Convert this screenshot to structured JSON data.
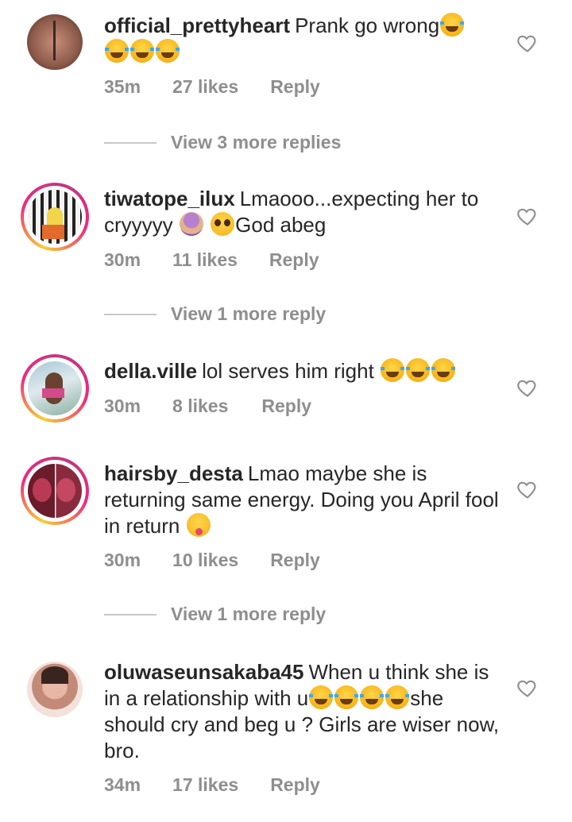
{
  "comments": [
    {
      "username": "official_prettyheart",
      "text_before": "Prank go wrong",
      "emoji_line": "😂😂😂😂",
      "time": "35m",
      "likes": "27 likes",
      "reply": "Reply",
      "view_replies": "View 3 more replies"
    },
    {
      "username": "tiwatope_ilux",
      "text": "Lmaooo...expecting her to cryyyyy",
      "text_after": "God abeg",
      "time": "30m",
      "likes": "11 likes",
      "reply": "Reply",
      "view_replies": "View 1 more reply"
    },
    {
      "username": "della.ville",
      "text": "lol serves him right",
      "time": "30m",
      "likes": "8 likes",
      "reply": "Reply"
    },
    {
      "username": "hairsby_desta",
      "text": "Lmao maybe she is returning same energy. Doing you April fool in return",
      "time": "30m",
      "likes": "10 likes",
      "reply": "Reply",
      "view_replies": "View 1 more reply"
    },
    {
      "username": "oluwaseunsakaba45",
      "text_before": "When u think she is in a relationship with u",
      "text_after": "she should cry and beg u ? Girls are wiser now, bro.",
      "time": "34m",
      "likes": "17 likes",
      "reply": "Reply"
    }
  ],
  "icons": {
    "like": "heart-outline-icon"
  },
  "colors": {
    "text": "#262626",
    "meta": "#8e8e8e",
    "divider": "#c7c7c7"
  }
}
